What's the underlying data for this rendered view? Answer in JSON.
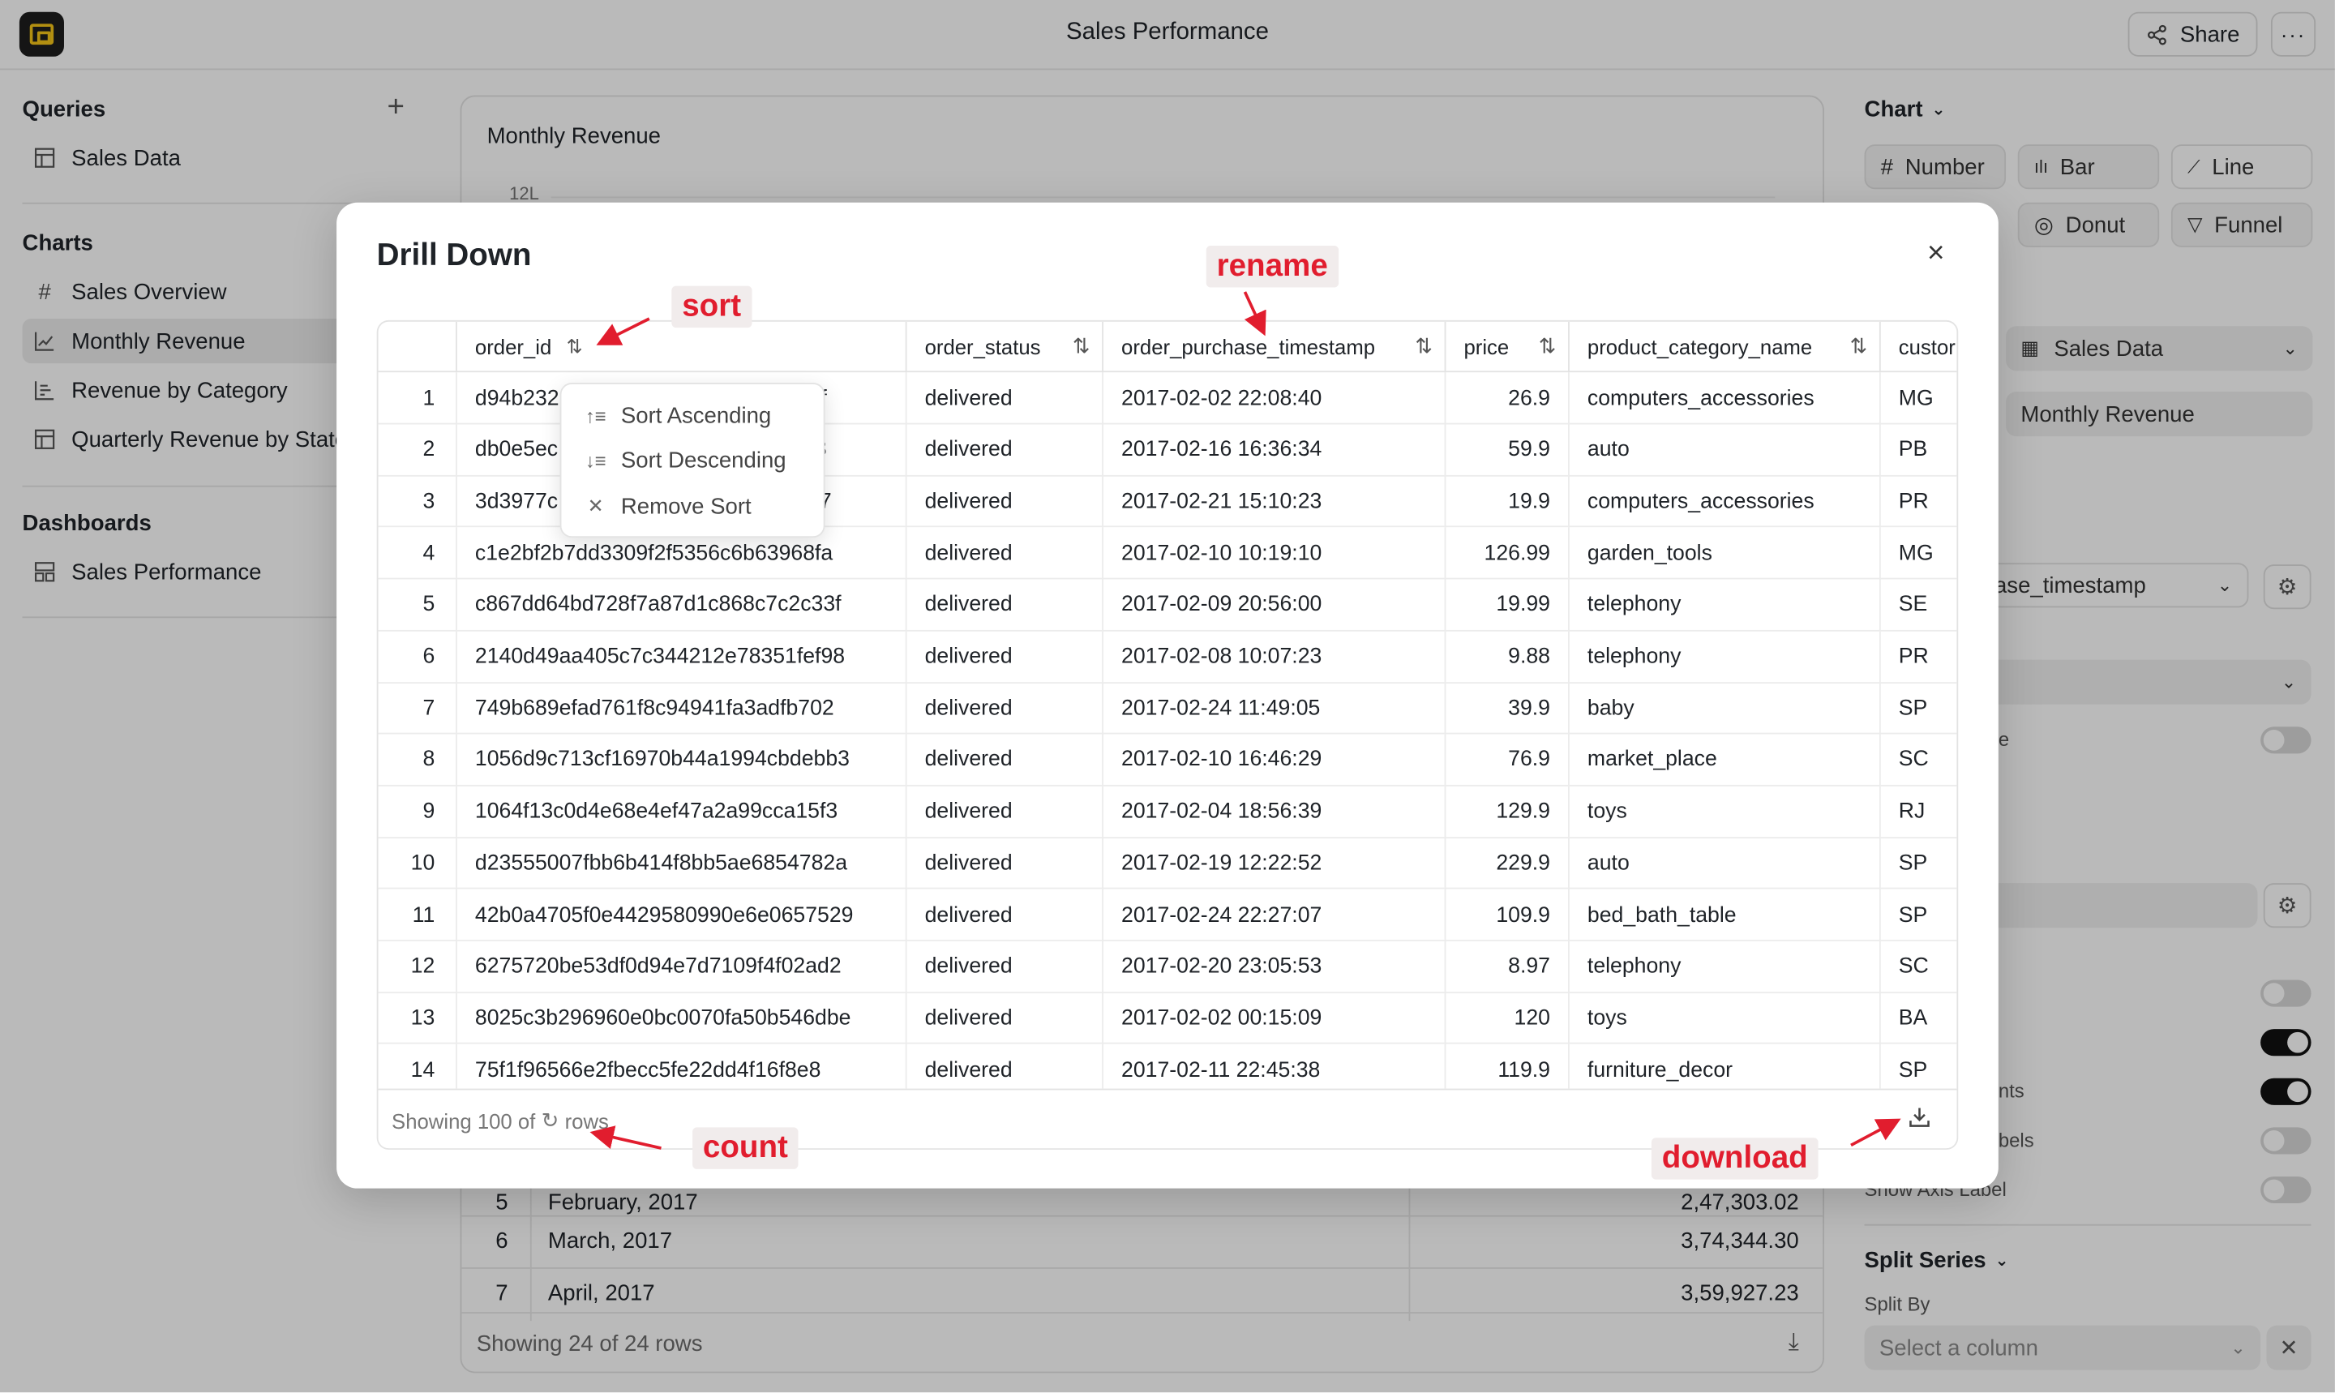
{
  "header": {
    "title": "Sales Performance",
    "share_label": "Share",
    "more_label": "···"
  },
  "sidebar": {
    "queries_title": "Queries",
    "add_label": "+",
    "queries": [
      {
        "label": "Sales Data",
        "icon": "table-icon"
      }
    ],
    "charts_title": "Charts",
    "charts": [
      {
        "label": "Sales Overview",
        "icon": "hash-icon"
      },
      {
        "label": "Monthly Revenue",
        "icon": "line-chart-icon",
        "active": true
      },
      {
        "label": "Revenue by Category",
        "icon": "bar-chart-icon"
      },
      {
        "label": "Quarterly Revenue by State",
        "icon": "table-icon"
      }
    ],
    "dashboards_title": "Dashboards",
    "dashboards": [
      {
        "label": "Sales Performance",
        "icon": "dashboard-icon"
      }
    ]
  },
  "main": {
    "chart_title": "Monthly Revenue",
    "tick_label": "12L",
    "rows": [
      {
        "n": "5",
        "month": "February, 2017",
        "value": "2,47,303.02"
      },
      {
        "n": "6",
        "month": "March, 2017",
        "value": "3,74,344.30"
      },
      {
        "n": "7",
        "month": "April, 2017",
        "value": "3,59,927.23"
      }
    ],
    "footer_text": "Showing 24 of 24 rows"
  },
  "right_panel": {
    "chart_title": "Chart",
    "types": [
      "Number",
      "Bar",
      "Line",
      "Donut",
      "Funnel"
    ],
    "query_select": "Sales Data",
    "title_value": "Monthly Revenue",
    "axis_select_fragment": "hase_timestamp",
    "partial_1": "e",
    "partial_2": "e",
    "partial_3": "nts",
    "partial_4": "bels",
    "show_axis_label": "Show Axis Label",
    "split_title": "Split Series",
    "split_by": "Split By",
    "split_placeholder": "Select a column"
  },
  "modal": {
    "title": "Drill Down",
    "close_label": "×",
    "columns": [
      "order_id",
      "order_status",
      "order_purchase_timestamp",
      "price",
      "product_category_name",
      "custor"
    ],
    "rows": [
      {
        "idx": "1",
        "order_id": "d94b232",
        "order_id_tail": "1b3f",
        "status": "delivered",
        "ts": "2017-02-02 22:08:40",
        "price": "26.9",
        "cat": "computers_accessories",
        "cust": "MG"
      },
      {
        "idx": "2",
        "order_id": "db0e5ec",
        "order_id_tail": "f78",
        "status": "delivered",
        "ts": "2017-02-16 16:36:34",
        "price": "59.9",
        "cat": "auto",
        "cust": "PB"
      },
      {
        "idx": "3",
        "order_id": "3d3977c",
        "order_id_tail": "c317",
        "status": "delivered",
        "ts": "2017-02-21 15:10:23",
        "price": "19.9",
        "cat": "computers_accessories",
        "cust": "PR"
      },
      {
        "idx": "4",
        "order_id": "c1e2bf2b7dd3309f2f5356c6b63968fa",
        "status": "delivered",
        "ts": "2017-02-10 10:19:10",
        "price": "126.99",
        "cat": "garden_tools",
        "cust": "MG"
      },
      {
        "idx": "5",
        "order_id": "c867dd64bd728f7a87d1c868c7c2c33f",
        "status": "delivered",
        "ts": "2017-02-09 20:56:00",
        "price": "19.99",
        "cat": "telephony",
        "cust": "SE"
      },
      {
        "idx": "6",
        "order_id": "2140d49aa405c7c344212e78351fef98",
        "status": "delivered",
        "ts": "2017-02-08 10:07:23",
        "price": "9.88",
        "cat": "telephony",
        "cust": "PR"
      },
      {
        "idx": "7",
        "order_id": "749b689efad761f8c94941fa3adfb702",
        "status": "delivered",
        "ts": "2017-02-24 11:49:05",
        "price": "39.9",
        "cat": "baby",
        "cust": "SP"
      },
      {
        "idx": "8",
        "order_id": "1056d9c713cf16970b44a1994cbdebb3",
        "status": "delivered",
        "ts": "2017-02-10 16:46:29",
        "price": "76.9",
        "cat": "market_place",
        "cust": "SC"
      },
      {
        "idx": "9",
        "order_id": "1064f13c0d4e68e4ef47a2a99cca15f3",
        "status": "delivered",
        "ts": "2017-02-04 18:56:39",
        "price": "129.9",
        "cat": "toys",
        "cust": "RJ"
      },
      {
        "idx": "10",
        "order_id": "d23555007fbb6b414f8bb5ae6854782a",
        "status": "delivered",
        "ts": "2017-02-19 12:22:52",
        "price": "229.9",
        "cat": "auto",
        "cust": "SP"
      },
      {
        "idx": "11",
        "order_id": "42b0a4705f0e4429580990e6e0657529",
        "status": "delivered",
        "ts": "2017-02-24 22:27:07",
        "price": "109.9",
        "cat": "bed_bath_table",
        "cust": "SP"
      },
      {
        "idx": "12",
        "order_id": "6275720be53df0d94e7d7109f4f02ad2",
        "status": "delivered",
        "ts": "2017-02-20 23:05:53",
        "price": "8.97",
        "cat": "telephony",
        "cust": "SC"
      },
      {
        "idx": "13",
        "order_id": "8025c3b296960e0bc0070fa50b546dbe",
        "status": "delivered",
        "ts": "2017-02-02 00:15:09",
        "price": "120",
        "cat": "toys",
        "cust": "BA"
      },
      {
        "idx": "14",
        "order_id": "75f1f96566e2fbecc5fe22dd4f16f8e8",
        "status": "delivered",
        "ts": "2017-02-11 22:45:38",
        "price": "119.9",
        "cat": "furniture_decor",
        "cust": "SP"
      }
    ],
    "footer_prefix": "Showing 100 of",
    "footer_suffix": "rows",
    "sort_menu": [
      "Sort Ascending",
      "Sort Descending",
      "Remove Sort"
    ]
  },
  "annotations": {
    "sort": "sort",
    "rename": "rename",
    "count": "count",
    "download": "download",
    "color": "#e11d2e"
  }
}
